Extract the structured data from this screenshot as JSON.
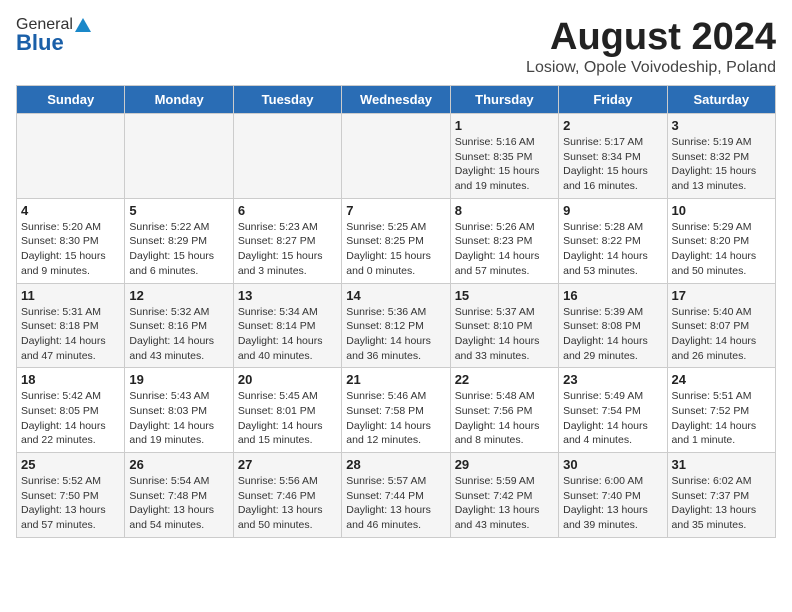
{
  "header": {
    "logo_general": "General",
    "logo_blue": "Blue",
    "title": "August 2024",
    "subtitle": "Losiow, Opole Voivodeship, Poland"
  },
  "weekdays": [
    "Sunday",
    "Monday",
    "Tuesday",
    "Wednesday",
    "Thursday",
    "Friday",
    "Saturday"
  ],
  "weeks": [
    [
      {
        "day": "",
        "info": ""
      },
      {
        "day": "",
        "info": ""
      },
      {
        "day": "",
        "info": ""
      },
      {
        "day": "",
        "info": ""
      },
      {
        "day": "1",
        "info": "Sunrise: 5:16 AM\nSunset: 8:35 PM\nDaylight: 15 hours\nand 19 minutes."
      },
      {
        "day": "2",
        "info": "Sunrise: 5:17 AM\nSunset: 8:34 PM\nDaylight: 15 hours\nand 16 minutes."
      },
      {
        "day": "3",
        "info": "Sunrise: 5:19 AM\nSunset: 8:32 PM\nDaylight: 15 hours\nand 13 minutes."
      }
    ],
    [
      {
        "day": "4",
        "info": "Sunrise: 5:20 AM\nSunset: 8:30 PM\nDaylight: 15 hours\nand 9 minutes."
      },
      {
        "day": "5",
        "info": "Sunrise: 5:22 AM\nSunset: 8:29 PM\nDaylight: 15 hours\nand 6 minutes."
      },
      {
        "day": "6",
        "info": "Sunrise: 5:23 AM\nSunset: 8:27 PM\nDaylight: 15 hours\nand 3 minutes."
      },
      {
        "day": "7",
        "info": "Sunrise: 5:25 AM\nSunset: 8:25 PM\nDaylight: 15 hours\nand 0 minutes."
      },
      {
        "day": "8",
        "info": "Sunrise: 5:26 AM\nSunset: 8:23 PM\nDaylight: 14 hours\nand 57 minutes."
      },
      {
        "day": "9",
        "info": "Sunrise: 5:28 AM\nSunset: 8:22 PM\nDaylight: 14 hours\nand 53 minutes."
      },
      {
        "day": "10",
        "info": "Sunrise: 5:29 AM\nSunset: 8:20 PM\nDaylight: 14 hours\nand 50 minutes."
      }
    ],
    [
      {
        "day": "11",
        "info": "Sunrise: 5:31 AM\nSunset: 8:18 PM\nDaylight: 14 hours\nand 47 minutes."
      },
      {
        "day": "12",
        "info": "Sunrise: 5:32 AM\nSunset: 8:16 PM\nDaylight: 14 hours\nand 43 minutes."
      },
      {
        "day": "13",
        "info": "Sunrise: 5:34 AM\nSunset: 8:14 PM\nDaylight: 14 hours\nand 40 minutes."
      },
      {
        "day": "14",
        "info": "Sunrise: 5:36 AM\nSunset: 8:12 PM\nDaylight: 14 hours\nand 36 minutes."
      },
      {
        "day": "15",
        "info": "Sunrise: 5:37 AM\nSunset: 8:10 PM\nDaylight: 14 hours\nand 33 minutes."
      },
      {
        "day": "16",
        "info": "Sunrise: 5:39 AM\nSunset: 8:08 PM\nDaylight: 14 hours\nand 29 minutes."
      },
      {
        "day": "17",
        "info": "Sunrise: 5:40 AM\nSunset: 8:07 PM\nDaylight: 14 hours\nand 26 minutes."
      }
    ],
    [
      {
        "day": "18",
        "info": "Sunrise: 5:42 AM\nSunset: 8:05 PM\nDaylight: 14 hours\nand 22 minutes."
      },
      {
        "day": "19",
        "info": "Sunrise: 5:43 AM\nSunset: 8:03 PM\nDaylight: 14 hours\nand 19 minutes."
      },
      {
        "day": "20",
        "info": "Sunrise: 5:45 AM\nSunset: 8:01 PM\nDaylight: 14 hours\nand 15 minutes."
      },
      {
        "day": "21",
        "info": "Sunrise: 5:46 AM\nSunset: 7:58 PM\nDaylight: 14 hours\nand 12 minutes."
      },
      {
        "day": "22",
        "info": "Sunrise: 5:48 AM\nSunset: 7:56 PM\nDaylight: 14 hours\nand 8 minutes."
      },
      {
        "day": "23",
        "info": "Sunrise: 5:49 AM\nSunset: 7:54 PM\nDaylight: 14 hours\nand 4 minutes."
      },
      {
        "day": "24",
        "info": "Sunrise: 5:51 AM\nSunset: 7:52 PM\nDaylight: 14 hours\nand 1 minute."
      }
    ],
    [
      {
        "day": "25",
        "info": "Sunrise: 5:52 AM\nSunset: 7:50 PM\nDaylight: 13 hours\nand 57 minutes."
      },
      {
        "day": "26",
        "info": "Sunrise: 5:54 AM\nSunset: 7:48 PM\nDaylight: 13 hours\nand 54 minutes."
      },
      {
        "day": "27",
        "info": "Sunrise: 5:56 AM\nSunset: 7:46 PM\nDaylight: 13 hours\nand 50 minutes."
      },
      {
        "day": "28",
        "info": "Sunrise: 5:57 AM\nSunset: 7:44 PM\nDaylight: 13 hours\nand 46 minutes."
      },
      {
        "day": "29",
        "info": "Sunrise: 5:59 AM\nSunset: 7:42 PM\nDaylight: 13 hours\nand 43 minutes."
      },
      {
        "day": "30",
        "info": "Sunrise: 6:00 AM\nSunset: 7:40 PM\nDaylight: 13 hours\nand 39 minutes."
      },
      {
        "day": "31",
        "info": "Sunrise: 6:02 AM\nSunset: 7:37 PM\nDaylight: 13 hours\nand 35 minutes."
      }
    ]
  ]
}
